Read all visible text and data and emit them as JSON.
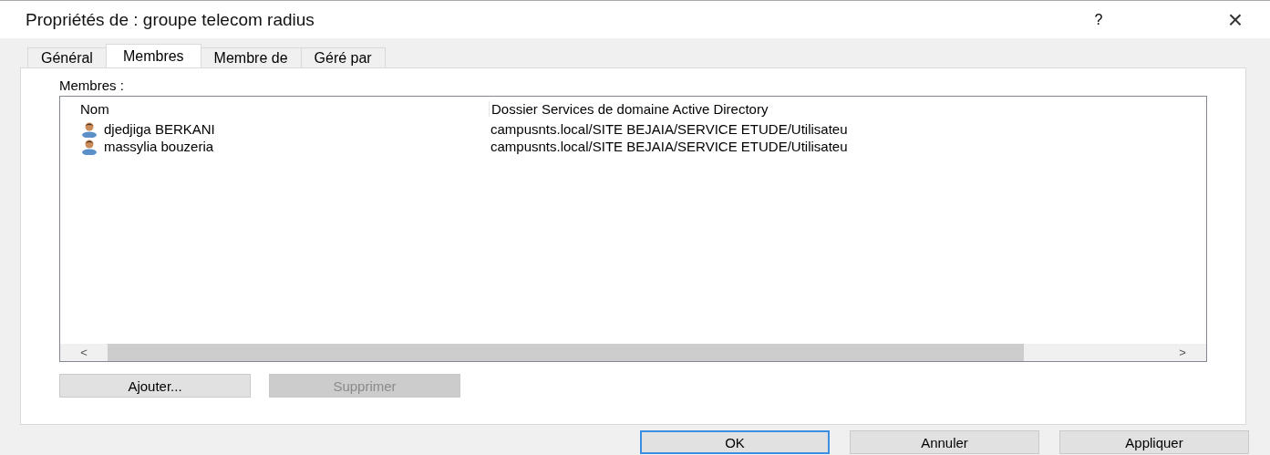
{
  "window": {
    "title": "Propriétés de : groupe telecom radius",
    "help": "?",
    "close": "×"
  },
  "tabs": [
    {
      "label": "Général",
      "selected": false
    },
    {
      "label": "Membres",
      "selected": true
    },
    {
      "label": "Membre de",
      "selected": false
    },
    {
      "label": "Géré par",
      "selected": false
    }
  ],
  "members_label": "Membres :",
  "table": {
    "columns": [
      "Nom",
      "Dossier Services de domaine Active Directory"
    ],
    "rows": [
      {
        "name": "djedjiga BERKANI",
        "folder": "campusnts.local/SITE BEJAIA/SERVICE ETUDE/Utilisateu"
      },
      {
        "name": "massylia bouzeria",
        "folder": "campusnts.local/SITE BEJAIA/SERVICE ETUDE/Utilisateu"
      }
    ],
    "scroll_left": "<",
    "scroll_right": ">"
  },
  "list_buttons": [
    {
      "label": "Ajouter...",
      "disabled": false
    },
    {
      "label": "Supprimer",
      "disabled": true
    }
  ],
  "dialog_buttons": [
    {
      "label": "OK",
      "default": true
    },
    {
      "label": "Annuler",
      "default": false
    },
    {
      "label": "Appliquer",
      "default": false
    }
  ]
}
